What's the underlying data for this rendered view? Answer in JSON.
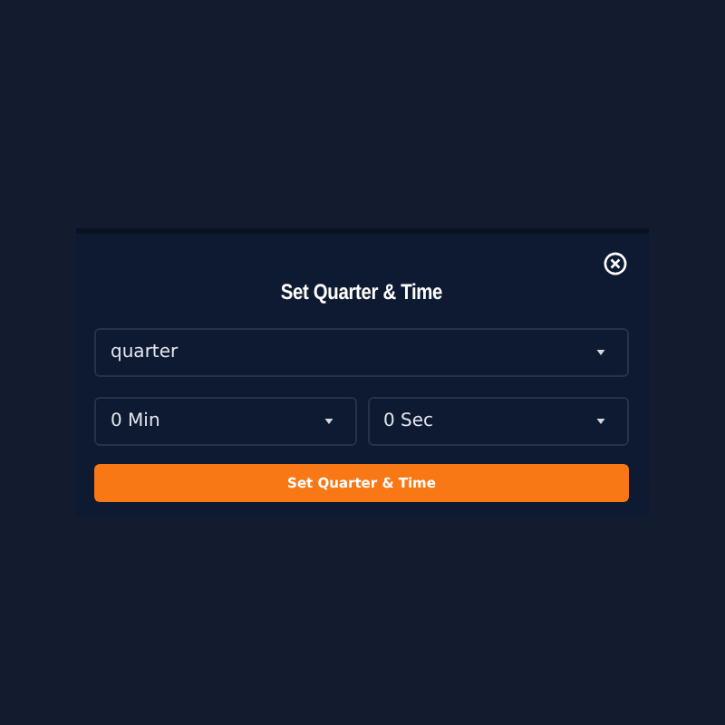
{
  "dialog": {
    "title": "Set Quarter & Time",
    "quarter_select": {
      "value": "quarter"
    },
    "minutes_select": {
      "value": "0 Min"
    },
    "seconds_select": {
      "value": "0 Sec"
    },
    "submit_button": {
      "label": "Set Quarter & Time"
    }
  }
}
